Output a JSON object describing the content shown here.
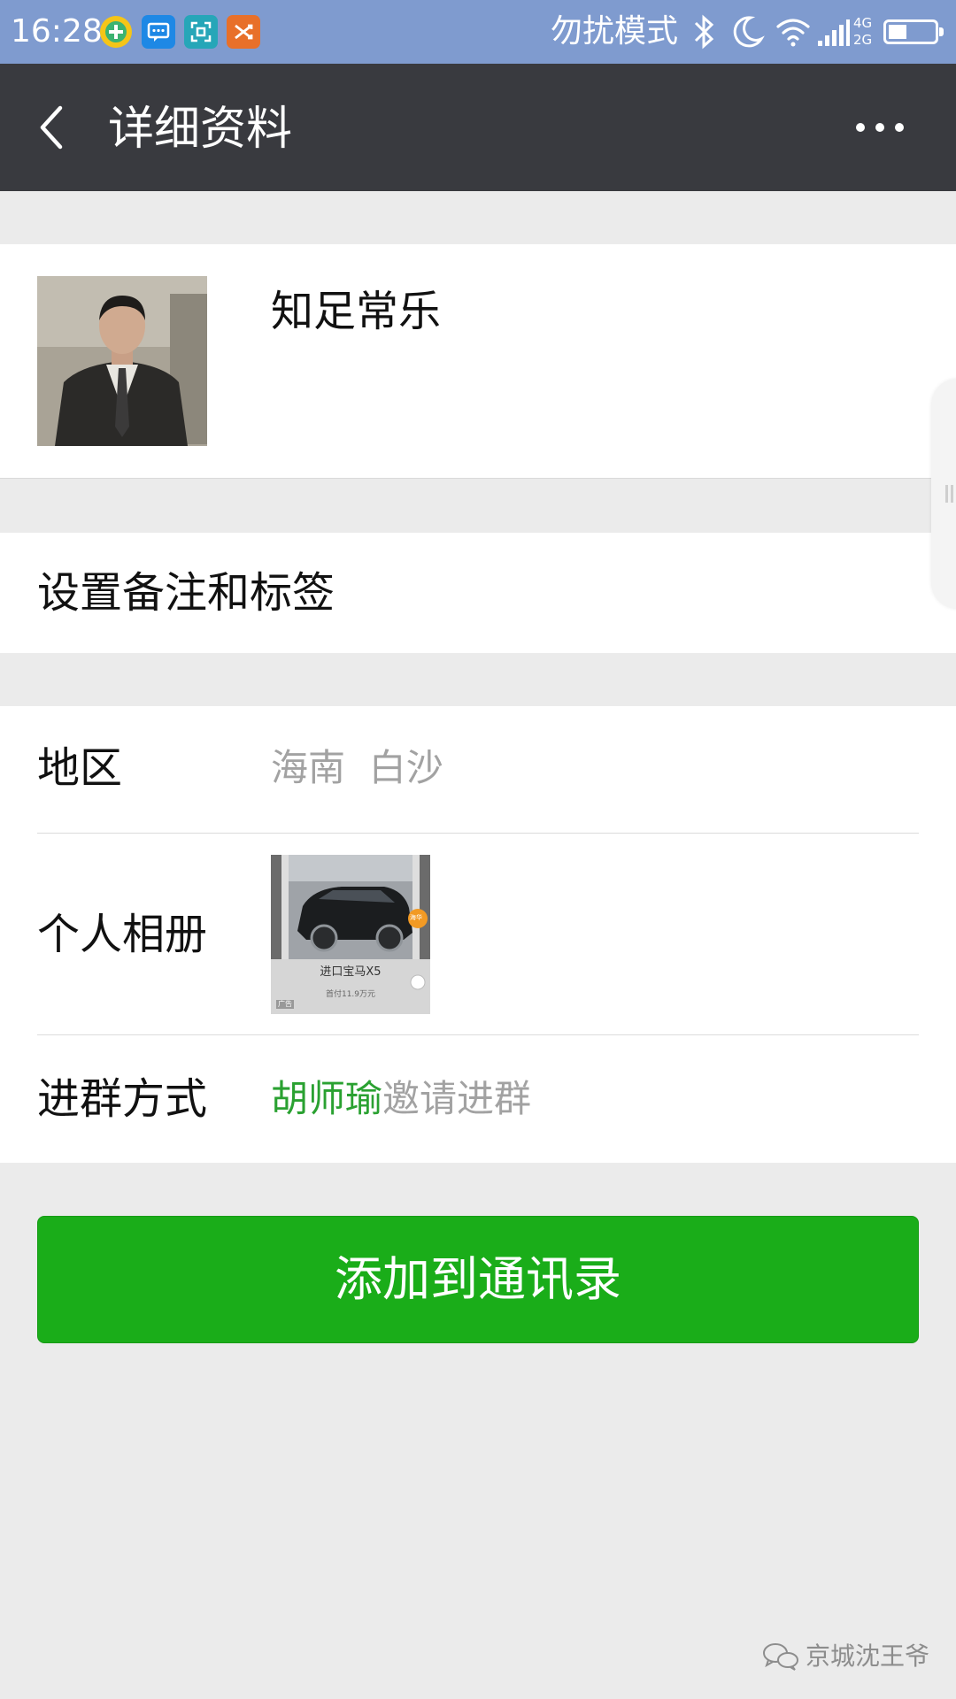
{
  "status_bar": {
    "time": "16:28",
    "dnd_text": "勿扰模式",
    "network_top": "4G",
    "network_bottom": "2G",
    "battery_level": 0.4,
    "icons": [
      "360-plus-icon",
      "message-icon",
      "scan-icon",
      "shuffle-icon",
      "bluetooth-icon",
      "moon-icon",
      "wifi-icon",
      "signal-icon",
      "battery-icon"
    ]
  },
  "app_bar": {
    "title": "详细资料",
    "back_icon": "back-arrow-icon",
    "more_icon": "more-icon"
  },
  "profile": {
    "nickname": "知足常乐"
  },
  "remark": {
    "label": "设置备注和标签"
  },
  "info": {
    "region_label": "地区",
    "region_value": "海南  白沙",
    "album_label": "个人相册",
    "album_thumb_caption": "进口宝马X5",
    "album_thumb_sub": "首付11.9万元",
    "album_thumb_badge": "广告",
    "album_thumb_tag": "海华",
    "join_label": "进群方式",
    "join_inviter": "胡师瑜",
    "join_suffix": "邀请进群"
  },
  "actions": {
    "add_contact": "添加到通讯录"
  },
  "watermark": {
    "text": "京城沈王爷"
  },
  "colors": {
    "status_bar": "#7f9bcf",
    "app_bar": "#393a3f",
    "primary_button": "#1aad19",
    "inviter_green": "#2aa131",
    "page_background": "#ebebeb"
  }
}
